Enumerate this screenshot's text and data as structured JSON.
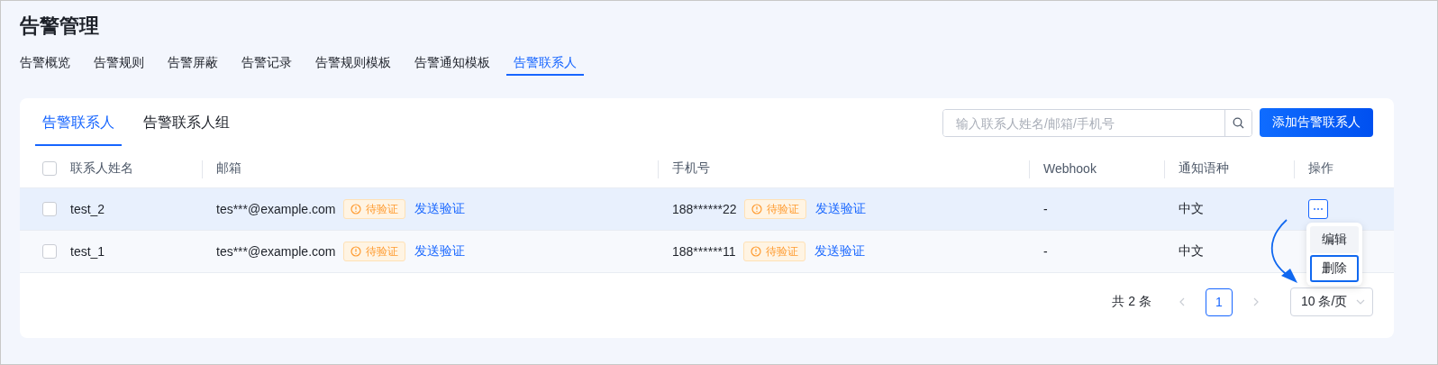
{
  "page": {
    "title": "告警管理"
  },
  "tabs": [
    {
      "label": "告警概览",
      "selected": false
    },
    {
      "label": "告警规则",
      "selected": false
    },
    {
      "label": "告警屏蔽",
      "selected": false
    },
    {
      "label": "告警记录",
      "selected": false
    },
    {
      "label": "告警规则模板",
      "selected": false
    },
    {
      "label": "告警通知模板",
      "selected": false
    },
    {
      "label": "告警联系人",
      "selected": true
    }
  ],
  "card": {
    "tabs": [
      {
        "label": "告警联系人",
        "selected": true
      },
      {
        "label": "告警联系人组",
        "selected": false
      }
    ],
    "search": {
      "placeholder": "输入联系人姓名/邮箱/手机号"
    },
    "add_button": "添加告警联系人"
  },
  "table": {
    "select_all_checked": false,
    "columns": [
      "联系人姓名",
      "邮箱",
      "手机号",
      "Webhook",
      "通知语种",
      "操作"
    ],
    "rows": [
      {
        "checked": false,
        "hovered": true,
        "menu_open": true,
        "name": "test_2",
        "email": "tes***@example.com",
        "email_status": "待验证",
        "email_action": "发送验证",
        "phone": "188******22",
        "phone_status": "待验证",
        "phone_action": "发送验证",
        "webhook": "-",
        "language": "中文"
      },
      {
        "checked": false,
        "hovered": false,
        "menu_open": false,
        "name": "test_1",
        "email": "tes***@example.com",
        "email_status": "待验证",
        "email_action": "发送验证",
        "phone": "188******11",
        "phone_status": "待验证",
        "phone_action": "发送验证",
        "webhook": "-",
        "language": "中文"
      }
    ]
  },
  "row_menu": {
    "items": [
      {
        "label": "编辑",
        "hovered": true,
        "outlined": false
      },
      {
        "label": "删除",
        "hovered": false,
        "outlined": true
      }
    ]
  },
  "pagination": {
    "total": "共 2 条",
    "prev_disabled": true,
    "next_disabled": true,
    "pages": [
      {
        "label": "1",
        "selected": true
      }
    ],
    "page_size": "10 条/页"
  }
}
